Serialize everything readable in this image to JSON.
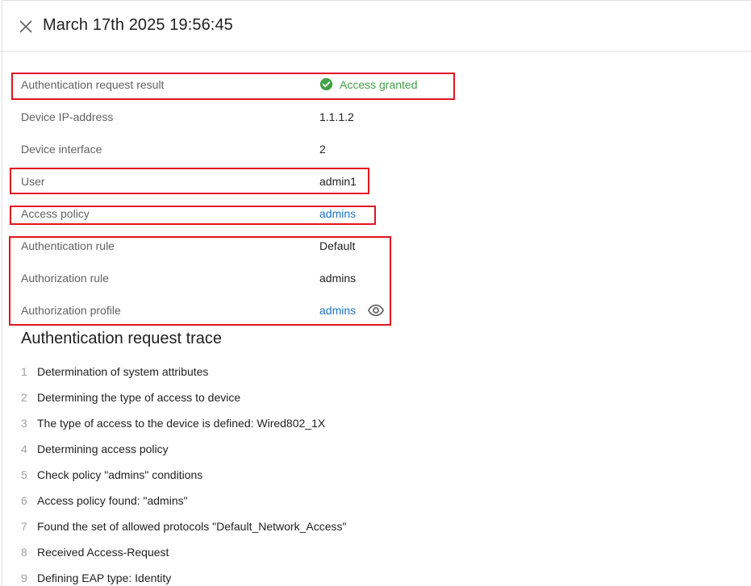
{
  "header": {
    "title": "March 17th 2025 19:56:45",
    "close_icon": "close-icon"
  },
  "details": [
    {
      "label": "Authentication request result",
      "value": "Access granted",
      "type": "status",
      "icon": "check-circle-icon",
      "color": "#43a047"
    },
    {
      "label": "Device IP-address",
      "value": "1.1.1.2",
      "type": "text"
    },
    {
      "label": "Device interface",
      "value": "2",
      "type": "text"
    },
    {
      "label": "User",
      "value": "admin1",
      "type": "text"
    },
    {
      "label": "Access policy",
      "value": "admins",
      "type": "link"
    },
    {
      "label": "Authentication rule",
      "value": "Default",
      "type": "text"
    },
    {
      "label": "Authorization rule",
      "value": "admins",
      "type": "text"
    },
    {
      "label": "Authorization profile",
      "value": "admins",
      "type": "link",
      "extra_icon": "eye-icon"
    }
  ],
  "trace": {
    "title": "Authentication request trace",
    "items": [
      {
        "num": "1",
        "text": "Determination of system attributes"
      },
      {
        "num": "2",
        "text": "Determining the type of access to device"
      },
      {
        "num": "3",
        "text": "The type of access to the device is defined: Wired802_1X"
      },
      {
        "num": "4",
        "text": "Determining access policy"
      },
      {
        "num": "5",
        "text": "Check policy \"admins\" conditions"
      },
      {
        "num": "6",
        "text": "Access policy found: \"admins\""
      },
      {
        "num": "7",
        "text": "Found the set of allowed protocols \"Default_Network_Access\""
      },
      {
        "num": "8",
        "text": "Received Access-Request"
      },
      {
        "num": "9",
        "text": "Defining EAP type: Identity"
      }
    ]
  },
  "colors": {
    "link": "#1a73c8",
    "granted": "#43a047",
    "highlight": "#e3141e"
  }
}
